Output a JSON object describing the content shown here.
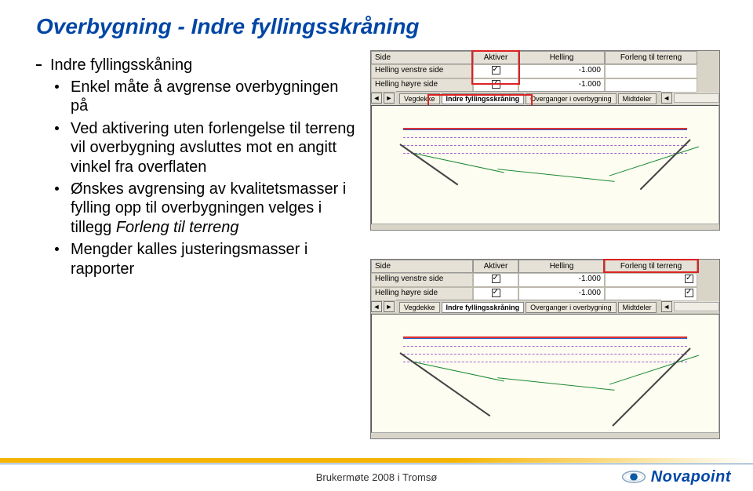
{
  "title": "Overbygning  - Indre fyllingsskråning",
  "bullets": {
    "l1": "Indre fyllingsskåning",
    "l2a": "Enkel måte å avgrense overbygningen på",
    "l2b": "Ved aktivering uten forlengelse til terreng vil overbygning avsluttes mot en angitt vinkel fra overflaten",
    "l2c_pre": "Ønskes avgrensing av kvalitetsmasser i fylling opp til overbygningen velges i tillegg ",
    "l2c_em": "Forleng til terreng",
    "l2d": "Mengder kalles justeringsmasser i rapporter"
  },
  "grid": {
    "headers": {
      "side": "Side",
      "aktiver": "Aktiver",
      "helling": "Helling",
      "forleng": "Forleng til terreng"
    },
    "rows": [
      {
        "side": "Helling venstre side",
        "helling": "-1.000",
        "forleng": ""
      },
      {
        "side": "Helling høyre side",
        "helling": "-1.000",
        "forleng": ""
      }
    ]
  },
  "tabs": {
    "t1": "Vegdekke",
    "t2": "Indre fyllingsskråning",
    "t3": "Overganger i overbygning",
    "t4": "Midtdeler"
  },
  "footer": "Brukermøte 2008 i Tromsø",
  "logo": "Novapoint"
}
